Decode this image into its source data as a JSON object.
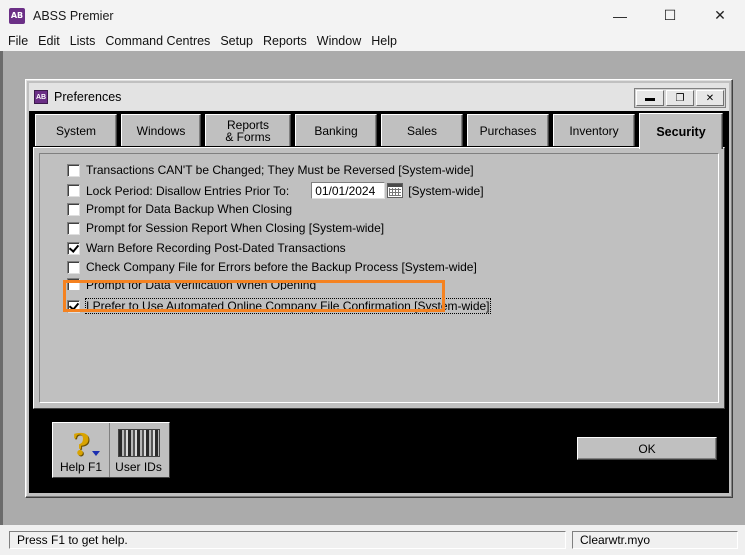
{
  "app": {
    "icon_text": "AB",
    "title": "ABSS Premier",
    "controls": {
      "minimize": "—",
      "maximize": "☐",
      "close": "✕"
    }
  },
  "menu": {
    "items": [
      "File",
      "Edit",
      "Lists",
      "Command Centres",
      "Setup",
      "Reports",
      "Window",
      "Help"
    ]
  },
  "preferences": {
    "icon_text": "AB",
    "title": "Preferences",
    "controls": {
      "minimize": "▬",
      "restore": "❐",
      "close": "✕"
    },
    "tabs": [
      {
        "label": "System",
        "mnemonic": "y"
      },
      {
        "label": "Windows",
        "mnemonic": "W"
      },
      {
        "label_line1": "Reports",
        "label_line2": "& Forms"
      },
      {
        "label": "Banking",
        "mnemonic": "n"
      },
      {
        "label": "Sales",
        "mnemonic": "S"
      },
      {
        "label": "Purchases",
        "mnemonic": "P"
      },
      {
        "label": "Inventory",
        "mnemonic": "v"
      },
      {
        "label": "Security",
        "active": true
      }
    ],
    "security": {
      "options": [
        {
          "label": "Transactions CAN'T be Changed; They Must be Reversed [System-wide]",
          "checked": false
        },
        {
          "label": "Lock Period: Disallow Entries Prior To:",
          "checked": false,
          "date": "01/01/2024",
          "suffix": "[System-wide]"
        },
        {
          "label": "Prompt for Data Backup When Closing",
          "checked": false
        },
        {
          "label": "Prompt for Session Report When Closing [System-wide]",
          "checked": false
        },
        {
          "label": "Warn Before Recording Post-Dated Transactions",
          "checked": true
        },
        {
          "label": "Check Company File for Errors before the Backup Process [System-wide]",
          "checked": false
        },
        {
          "label": "Prompt for Data Verification When Opening",
          "checked": false
        },
        {
          "label": "I Prefer to Use Automated Online Company File Confirmation [System-wide]",
          "checked": true
        }
      ]
    },
    "toolbar": {
      "help_label": "Help F1",
      "user_ids_label": "User IDs",
      "help_icon": "question-mark-icon",
      "user_ids_icon": "user-ids-icon"
    },
    "ok_label": "OK"
  },
  "status": {
    "help_text": "Press F1 to get help.",
    "file_name": "Clearwtr.myo"
  },
  "colors": {
    "highlight": "#f58220",
    "app_icon": "#6b2f86"
  }
}
